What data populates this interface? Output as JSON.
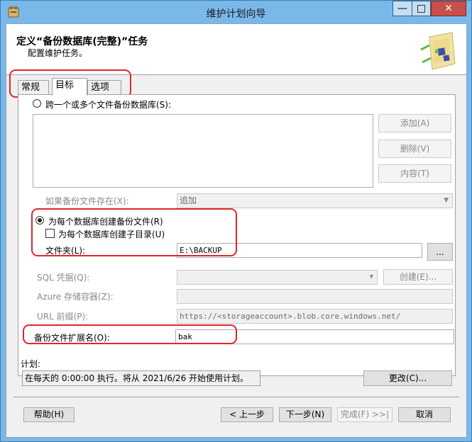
{
  "window": {
    "title": "维护计划向导",
    "minimize_label": "—",
    "maximize_label": "□",
    "close_label": "✕"
  },
  "header": {
    "title": "定义“备份数据库(完整)”任务",
    "subtitle": "配置维护任务。"
  },
  "tabs": [
    {
      "label": "常规",
      "active": false
    },
    {
      "label": "目标",
      "active": true
    },
    {
      "label": "选项",
      "active": false
    }
  ],
  "target": {
    "span_files_label": "跨一个或多个文件备份数据库(S):",
    "add_button": "添加(A)",
    "remove_button": "删除(V)",
    "contents_button": "内容(T)",
    "if_exists_label": "如果备份文件存在(X):",
    "if_exists_value": "追加",
    "per_db_file_label": "为每个数据库创建备份文件(R)",
    "per_db_subdir_label": "为每个数据库创建子目录(U)",
    "folder_label": "文件夹(L):",
    "folder_value": "E:\\BACKUP",
    "browse_button": "...",
    "sql_credential_label": "SQL 凭据(Q):",
    "sql_credential_value": "",
    "create_button": "创建(E)...",
    "azure_container_label": "Azure 存储容器(Z):",
    "url_prefix_label": "URL 前缀(P):",
    "url_prefix_value": "https://<storageaccount>.blob.core.windows.net/",
    "extension_label": "备份文件扩展名(O):",
    "extension_value": "bak"
  },
  "schedule": {
    "label": "计划:",
    "value": "在每天的 0:00:00 执行。将从 2021/6/26 开始使用计划。",
    "change_button": "更改(C)..."
  },
  "footer": {
    "help_button": "帮助(H)",
    "back_button": "< 上一步",
    "next_button": "下一步(N)",
    "finish_button": "完成(F) >>|",
    "cancel_button": "取消"
  },
  "colors": {
    "titlebar": "#7ab8e9",
    "highlight": "#e0262b",
    "close_button": "#c7504a"
  }
}
